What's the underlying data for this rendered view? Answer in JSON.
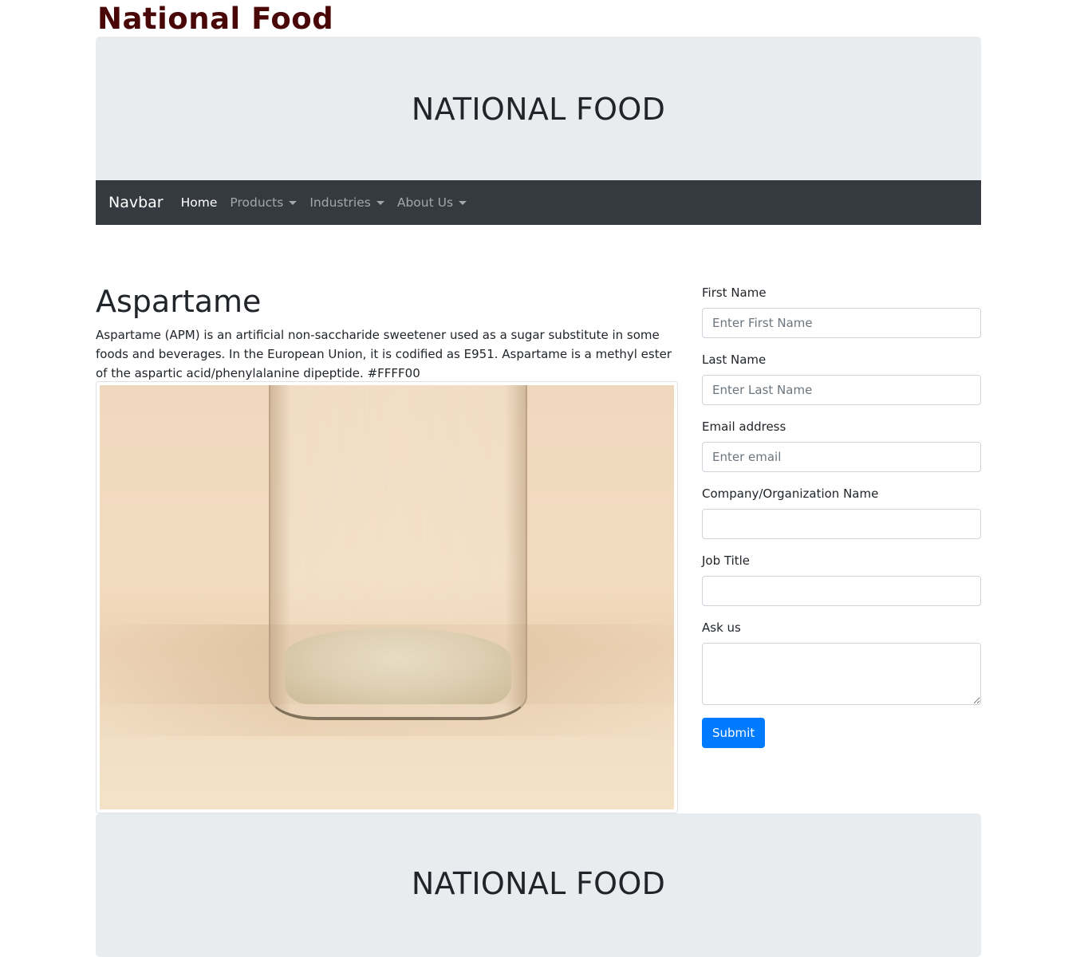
{
  "site": {
    "brand_title": "National Food",
    "jumbotron_title": "NATIONAL FOOD"
  },
  "navbar": {
    "brand": "Navbar",
    "items": [
      {
        "label": "Home",
        "active": true,
        "dropdown": false
      },
      {
        "label": "Products",
        "active": false,
        "dropdown": true
      },
      {
        "label": "Industries",
        "active": false,
        "dropdown": true
      },
      {
        "label": "About Us",
        "active": false,
        "dropdown": true
      }
    ]
  },
  "article": {
    "heading": "Aspartame",
    "body": "Aspartame (APM) is an artificial non-saccharide sweetener used as a sugar substitute in some foods and beverages. In the European Union, it is codified as E951. Aspartame is a methyl ester of the aspartic acid/phenylalanine dipeptide. #FFFF00"
  },
  "form": {
    "first_name": {
      "label": "First Name",
      "placeholder": "Enter First Name",
      "value": ""
    },
    "last_name": {
      "label": "Last Name",
      "placeholder": "Enter Last Name",
      "value": ""
    },
    "email": {
      "label": "Email address",
      "placeholder": "Enter email",
      "value": ""
    },
    "company": {
      "label": "Company/Organization Name",
      "placeholder": "",
      "value": ""
    },
    "job_title": {
      "label": "Job Title",
      "placeholder": "",
      "value": ""
    },
    "ask_us": {
      "label": "Ask us",
      "placeholder": "",
      "value": ""
    },
    "submit_label": "Submit"
  },
  "colors": {
    "brand_title": "#4a0707",
    "jumbotron_bg": "#e9ecef",
    "navbar_bg": "#343a40",
    "primary_button": "#007bff"
  }
}
